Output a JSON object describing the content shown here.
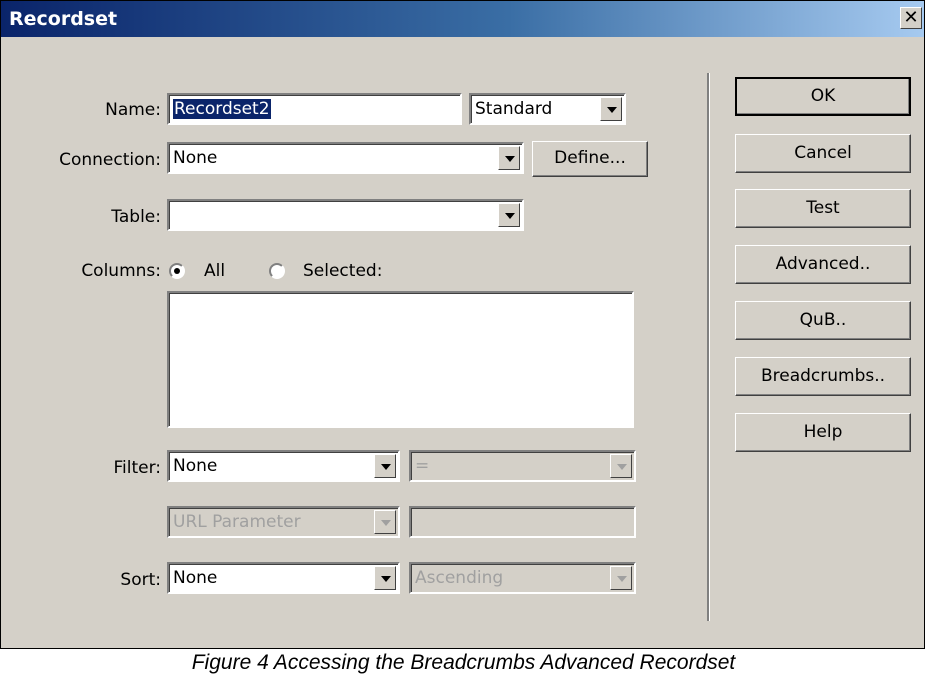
{
  "window": {
    "title": "Recordset",
    "close_glyph": "✕",
    "close_icon": "close-icon"
  },
  "form": {
    "name_label": "Name:",
    "name_value": "Recordset2",
    "name_type": "Standard",
    "connection_label": "Connection:",
    "connection_value": "None",
    "define_label": "Define...",
    "table_label": "Table:",
    "table_value": "",
    "columns_label": "Columns:",
    "columns_all": "All",
    "columns_selected": "Selected:",
    "columns_choice": "All",
    "filter_label": "Filter:",
    "filter_value": "None",
    "filter_operator": "=",
    "filter_param_type": "URL Parameter",
    "filter_param_value": "",
    "sort_label": "Sort:",
    "sort_value": "None",
    "sort_direction": "Ascending"
  },
  "buttons": {
    "ok": "OK",
    "cancel": "Cancel",
    "test": "Test",
    "advanced": "Advanced..",
    "qub": "QuB..",
    "breadcrumbs": "Breadcrumbs..",
    "help": "Help"
  },
  "caption": "Figure 4 Accessing the Breadcrumbs Advanced Recordset",
  "colors": {
    "titlebar_start": "#0a246a",
    "titlebar_end": "#a6caf0",
    "face": "#d4d0c8",
    "selection": "#0a246a"
  }
}
